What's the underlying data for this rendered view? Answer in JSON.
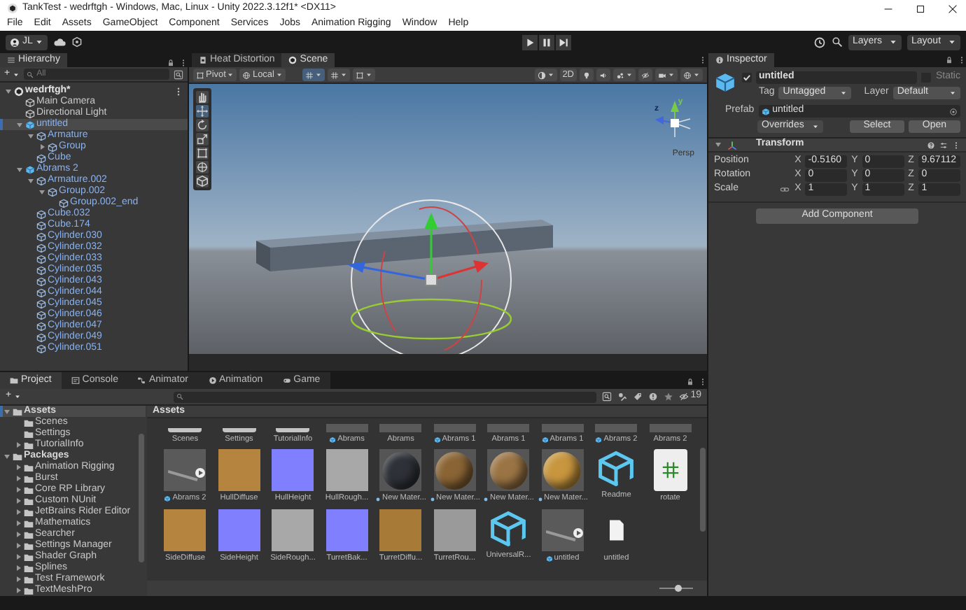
{
  "window": {
    "title": "TankTest - wedrftgh - Windows, Mac, Linux - Unity 2022.3.12f1* <DX11>"
  },
  "menu": [
    "File",
    "Edit",
    "Assets",
    "GameObject",
    "Component",
    "Services",
    "Jobs",
    "Animation Rigging",
    "Window",
    "Help"
  ],
  "toolbar": {
    "account": "JL",
    "layers": "Layers",
    "layout": "Layout"
  },
  "hierarchy": {
    "title": "Hierarchy",
    "add": "+",
    "search_placeholder": "All",
    "tree": [
      {
        "label": "wedrftgh*",
        "kind": "scene",
        "expanded": true,
        "selected": false,
        "children": [
          {
            "label": "Main Camera",
            "kind": "object",
            "selected": false
          },
          {
            "label": "Directional Light",
            "kind": "object",
            "selected": false
          },
          {
            "label": "untitled",
            "kind": "prefab_root",
            "expanded": true,
            "selected": true,
            "children": [
              {
                "label": "Armature",
                "kind": "prefab_child",
                "expanded": true,
                "selected": false,
                "children": [
                  {
                    "label": "Group",
                    "kind": "prefab_child",
                    "expanded": false,
                    "selected": false
                  }
                ]
              },
              {
                "label": "Cube",
                "kind": "prefab_child",
                "selected": false
              }
            ]
          },
          {
            "label": "Abrams 2",
            "kind": "prefab_root",
            "expanded": true,
            "selected": false,
            "children": [
              {
                "label": "Armature.002",
                "kind": "prefab_child",
                "expanded": true,
                "selected": false,
                "children": [
                  {
                    "label": "Group.002",
                    "kind": "prefab_child",
                    "expanded": true,
                    "selected": false,
                    "children": [
                      {
                        "label": "Group.002_end",
                        "kind": "prefab_child",
                        "selected": false
                      }
                    ]
                  }
                ]
              },
              {
                "label": "Cube.032",
                "kind": "prefab_child",
                "selected": false
              },
              {
                "label": "Cube.174",
                "kind": "prefab_child",
                "selected": false
              },
              {
                "label": "Cylinder.030",
                "kind": "prefab_child",
                "selected": false
              },
              {
                "label": "Cylinder.032",
                "kind": "prefab_child",
                "selected": false
              },
              {
                "label": "Cylinder.033",
                "kind": "prefab_child",
                "selected": false
              },
              {
                "label": "Cylinder.035",
                "kind": "prefab_child",
                "selected": false
              },
              {
                "label": "Cylinder.043",
                "kind": "prefab_child",
                "selected": false
              },
              {
                "label": "Cylinder.044",
                "kind": "prefab_child",
                "selected": false
              },
              {
                "label": "Cylinder.045",
                "kind": "prefab_child",
                "selected": false
              },
              {
                "label": "Cylinder.046",
                "kind": "prefab_child",
                "selected": false
              },
              {
                "label": "Cylinder.047",
                "kind": "prefab_child",
                "selected": false
              },
              {
                "label": "Cylinder.049",
                "kind": "prefab_child",
                "selected": false
              },
              {
                "label": "Cylinder.051",
                "kind": "prefab_child",
                "selected": false
              }
            ]
          }
        ]
      }
    ]
  },
  "scene_view": {
    "tabs": [
      {
        "label": "Heat Distortion",
        "selected": false
      },
      {
        "label": "Scene",
        "selected": true
      }
    ],
    "pivot": "Pivot",
    "space": "Local",
    "mode_2d": "2D",
    "gizmo_axes": [
      "y",
      "z"
    ],
    "gizmo_label": "Persp"
  },
  "inspector": {
    "title": "Inspector",
    "object": {
      "name": "untitled",
      "active": true,
      "static": false,
      "static_label": "Static",
      "tag_label": "Tag",
      "tag": "Untagged",
      "layer_label": "Layer",
      "layer": "Default"
    },
    "prefab": {
      "label": "Prefab",
      "asset": "untitled",
      "overrides": "Overrides",
      "select": "Select",
      "open": "Open"
    },
    "transform": {
      "title": "Transform",
      "expanded": true,
      "rows": [
        {
          "label": "Position",
          "kind": "vector",
          "values": [
            {
              "axis": "X",
              "value": "-0.5160"
            },
            {
              "axis": "Y",
              "value": "0"
            },
            {
              "axis": "Z",
              "value": "9.67112"
            }
          ]
        },
        {
          "label": "Rotation",
          "kind": "vector",
          "values": [
            {
              "axis": "X",
              "value": "0"
            },
            {
              "axis": "Y",
              "value": "0"
            },
            {
              "axis": "Z",
              "value": "0"
            }
          ]
        },
        {
          "label": "Scale",
          "kind": "scale",
          "values": [
            {
              "axis": "X",
              "value": "1"
            },
            {
              "axis": "Y",
              "value": "1"
            },
            {
              "axis": "Z",
              "value": "1"
            }
          ]
        }
      ]
    },
    "add_component": "Add Component"
  },
  "project": {
    "tabs": [
      {
        "label": "Project",
        "kind": "project",
        "selected": true
      },
      {
        "label": "Console",
        "kind": "console",
        "selected": false
      },
      {
        "label": "Animator",
        "kind": "animator",
        "selected": false
      },
      {
        "label": "Animation",
        "kind": "animation",
        "selected": false
      },
      {
        "label": "Game",
        "kind": "game",
        "selected": false
      }
    ],
    "add": "+",
    "hidden_count": "19",
    "tree": [
      {
        "label": "Assets",
        "kind": "root",
        "expanded": true,
        "selected": true,
        "children": [
          {
            "label": "Scenes",
            "kind": "folder",
            "selected": false
          },
          {
            "label": "Settings",
            "kind": "folder",
            "selected": false
          },
          {
            "label": "TutorialInfo",
            "kind": "folder",
            "expanded": false,
            "selected": false
          }
        ]
      },
      {
        "label": "Packages",
        "kind": "root",
        "expanded": true,
        "selected": false,
        "children": [
          {
            "label": "Animation Rigging",
            "kind": "folder",
            "expanded": false,
            "selected": false
          },
          {
            "label": "Burst",
            "kind": "folder",
            "expanded": false,
            "selected": false
          },
          {
            "label": "Core RP Library",
            "kind": "folder",
            "expanded": false,
            "selected": false
          },
          {
            "label": "Custom NUnit",
            "kind": "folder",
            "expanded": false,
            "selected": false
          },
          {
            "label": "JetBrains Rider Editor",
            "kind": "folder",
            "expanded": false,
            "selected": false
          },
          {
            "label": "Mathematics",
            "kind": "folder",
            "expanded": false,
            "selected": false
          },
          {
            "label": "Searcher",
            "kind": "folder",
            "expanded": false,
            "selected": false
          },
          {
            "label": "Settings Manager",
            "kind": "folder",
            "expanded": false,
            "selected": false
          },
          {
            "label": "Shader Graph",
            "kind": "folder",
            "expanded": false,
            "selected": false
          },
          {
            "label": "Splines",
            "kind": "folder",
            "expanded": false,
            "selected": false
          },
          {
            "label": "Test Framework",
            "kind": "folder",
            "expanded": false,
            "selected": false
          },
          {
            "label": "TextMeshPro",
            "kind": "folder",
            "expanded": false,
            "selected": false
          }
        ]
      }
    ],
    "breadcrumb": "Assets",
    "asset_rows": [
      {
        "clipped": true,
        "items": [
          {
            "label": "Scenes",
            "kind": "folder"
          },
          {
            "label": "Settings",
            "kind": "folder"
          },
          {
            "label": "TutorialInfo",
            "kind": "folder"
          },
          {
            "label": "Abrams",
            "kind": "prefab"
          },
          {
            "label": "Abrams",
            "kind": "model"
          },
          {
            "label": "Abrams 1",
            "kind": "prefab"
          },
          {
            "label": "Abrams 1",
            "kind": "model"
          },
          {
            "label": "Abrams 1",
            "kind": "prefab"
          },
          {
            "label": "Abrams 2",
            "kind": "prefab"
          },
          {
            "label": "Abrams 2",
            "kind": "model"
          }
        ]
      },
      {
        "clipped": false,
        "items": [
          {
            "label": "Abrams 2",
            "kind": "prefab"
          },
          {
            "label": "HullDiffuse",
            "kind": "texture",
            "color": "#b5843e"
          },
          {
            "label": "HullHeight",
            "kind": "texture",
            "color": "#8080ff"
          },
          {
            "label": "HullRough...",
            "kind": "texture",
            "color": "#a8a8a8"
          },
          {
            "label": "New Mater...",
            "kind": "material",
            "color": "#2e3238"
          },
          {
            "label": "New Mater...",
            "kind": "material",
            "color": "#8a6434"
          },
          {
            "label": "New Mater...",
            "kind": "material",
            "color": "#9a7444"
          },
          {
            "label": "New Mater...",
            "kind": "material",
            "color": "#c8963e"
          },
          {
            "label": "Readme",
            "kind": "asset"
          },
          {
            "label": "rotate",
            "kind": "script"
          }
        ]
      },
      {
        "clipped": false,
        "items": [
          {
            "label": "SideDiffuse",
            "kind": "texture",
            "color": "#b5843e"
          },
          {
            "label": "SideHeight",
            "kind": "texture",
            "color": "#8080ff"
          },
          {
            "label": "SideRough...",
            "kind": "texture",
            "color": "#a8a8a8"
          },
          {
            "label": "TurretBak...",
            "kind": "texture",
            "color": "#8080ff"
          },
          {
            "label": "TurretDiffu...",
            "kind": "texture",
            "color": "#a87a38"
          },
          {
            "label": "TurretRou...",
            "kind": "texture",
            "color": "#9a9a9a"
          },
          {
            "label": "UniversalR...",
            "kind": "asset"
          },
          {
            "label": "untitled",
            "kind": "prefab"
          },
          {
            "label": "untitled",
            "kind": "file"
          }
        ]
      }
    ],
    "zoom": {
      "level": 0.55
    }
  }
}
